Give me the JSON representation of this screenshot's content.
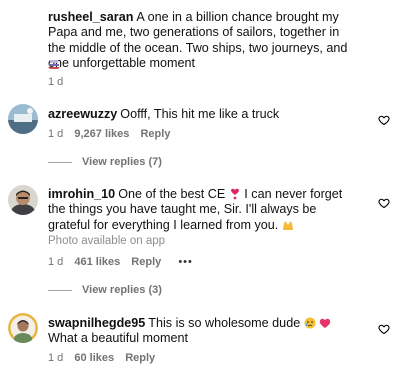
{
  "comments": [
    {
      "username": "rusheel_saran",
      "text": "A one in a billion chance brought my Papa and me, two generations of sailors, together in the middle of the ocean. Two ships, two journeys, and one unforgettable moment",
      "time": "1 d"
    },
    {
      "username": "azreewuzzy",
      "text": "Oofff, This hit me like a truck",
      "time": "1 d",
      "likes": "9,267 likes",
      "reply_label": "Reply",
      "view_replies": "View replies (7)"
    },
    {
      "username": "imrohin_10",
      "text_a": "One of the best CE",
      "text_b": "I can never forget the things you have taught me, Sir. I'll always be grateful for everything I learned from you.",
      "photo_note": "Photo available on app",
      "time": "1 d",
      "likes": "461 likes",
      "reply_label": "Reply",
      "more": "•••",
      "view_replies": "View replies (3)"
    },
    {
      "username": "swapnilhegde95",
      "text_a": "This is so wholesome dude",
      "text_b": "What a beautiful moment",
      "time": "1 d",
      "likes": "60 likes",
      "reply_label": "Reply"
    }
  ],
  "icons": {
    "heart": "heart-outline-icon",
    "ship_emoji": "ship-emoji-icon",
    "red_heart_exclamation": "heart-exclamation-emoji-icon",
    "raised_hands": "raised-hands-emoji-icon",
    "crying_face": "crying-face-emoji-icon",
    "pink_heart": "pink-heart-emoji-icon"
  },
  "colors": {
    "meta_text": "#737373",
    "heart_emoji": "#e0245e"
  }
}
